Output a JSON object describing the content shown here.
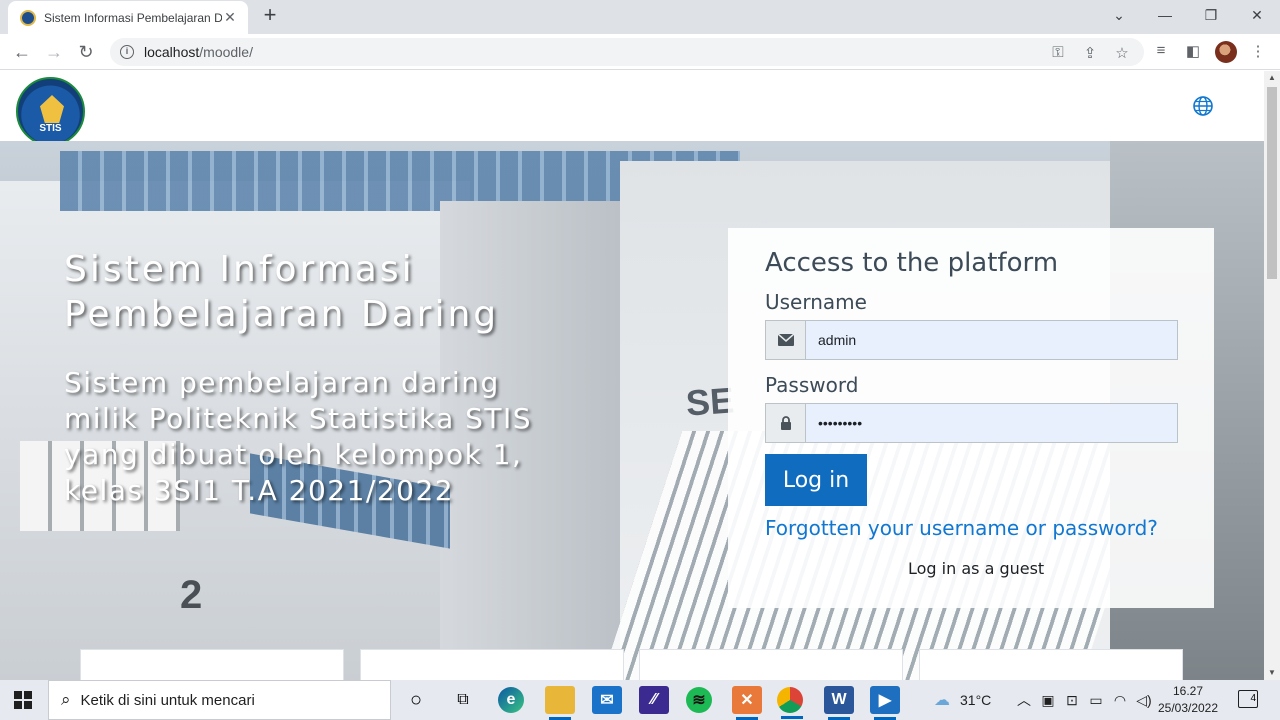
{
  "browser": {
    "tab_title": "Sistem Informasi Pembelajaran D",
    "url_host": "localhost",
    "url_path": "/moodle/"
  },
  "navbar": {
    "logo_text": "STIS",
    "logo_ring_text": "POLITEKNIK STATISTIKA"
  },
  "hero": {
    "title": "Sistem Informasi Pembelajaran Daring",
    "subtitle": "Sistem pembelajaran daring milik Politeknik Statistika STIS yang dibuat oleh kelompok 1, kelas 3SI1 T.A 2021/2022",
    "building_number": "2",
    "facade_text": "SE"
  },
  "login": {
    "heading": "Access to the platform",
    "username_label": "Username",
    "username_value": "admin",
    "password_label": "Password",
    "password_value": "•••••••••",
    "login_button": "Log in",
    "forgot_link": "Forgotten your username or password?",
    "guest_link": "Log in as a guest"
  },
  "taskbar": {
    "search_placeholder": "Ketik di sini untuk mencari",
    "temperature": "31°C",
    "time": "16.27",
    "date": "25/03/2022",
    "notification_count": "4"
  },
  "colors": {
    "primary": "#0f6cbf",
    "link": "#1177d1",
    "input_autofill": "#e8f0fe"
  }
}
